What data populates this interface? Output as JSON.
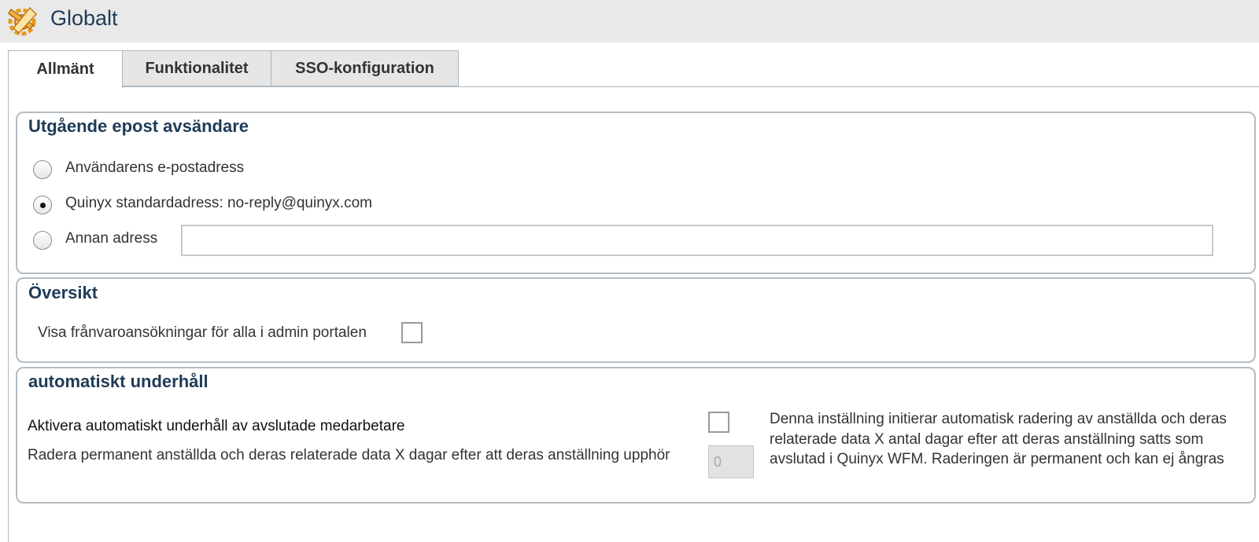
{
  "header": {
    "title": "Globalt",
    "icon": "settings-gear-icon"
  },
  "tabs": [
    {
      "label": "Allmänt",
      "active": true
    },
    {
      "label": "Funktionalitet",
      "active": false
    },
    {
      "label": "SSO-konfiguration",
      "active": false
    }
  ],
  "sender_section": {
    "title": "Utgående epost avsändare",
    "options": [
      {
        "label": "Användarens e-postadress",
        "checked": false
      },
      {
        "label": "Quinyx standardadress: no-reply@quinyx.com",
        "checked": true
      },
      {
        "label": "Annan adress",
        "checked": false
      }
    ],
    "other_address_value": ""
  },
  "overview_section": {
    "title": "Översikt",
    "absence_label": "Visa frånvaroansökningar för alla i admin portalen",
    "absence_checked": false
  },
  "maintenance_section": {
    "title": "automatiskt underhåll",
    "activate_label": "Aktivera automatiskt underhåll av avslutade medarbetare",
    "activate_checked": false,
    "delete_label": "Radera permanent anställda och deras relaterade data X dagar efter att deras anställning upphör",
    "delete_days_placeholder": "0",
    "description": "Denna inställning initierar automatisk radering av anställda och deras relaterade data X antal dagar efter att deras anställning satts som avslutad i Quinyx WFM. Raderingen är permanent och kan ej ångras"
  }
}
